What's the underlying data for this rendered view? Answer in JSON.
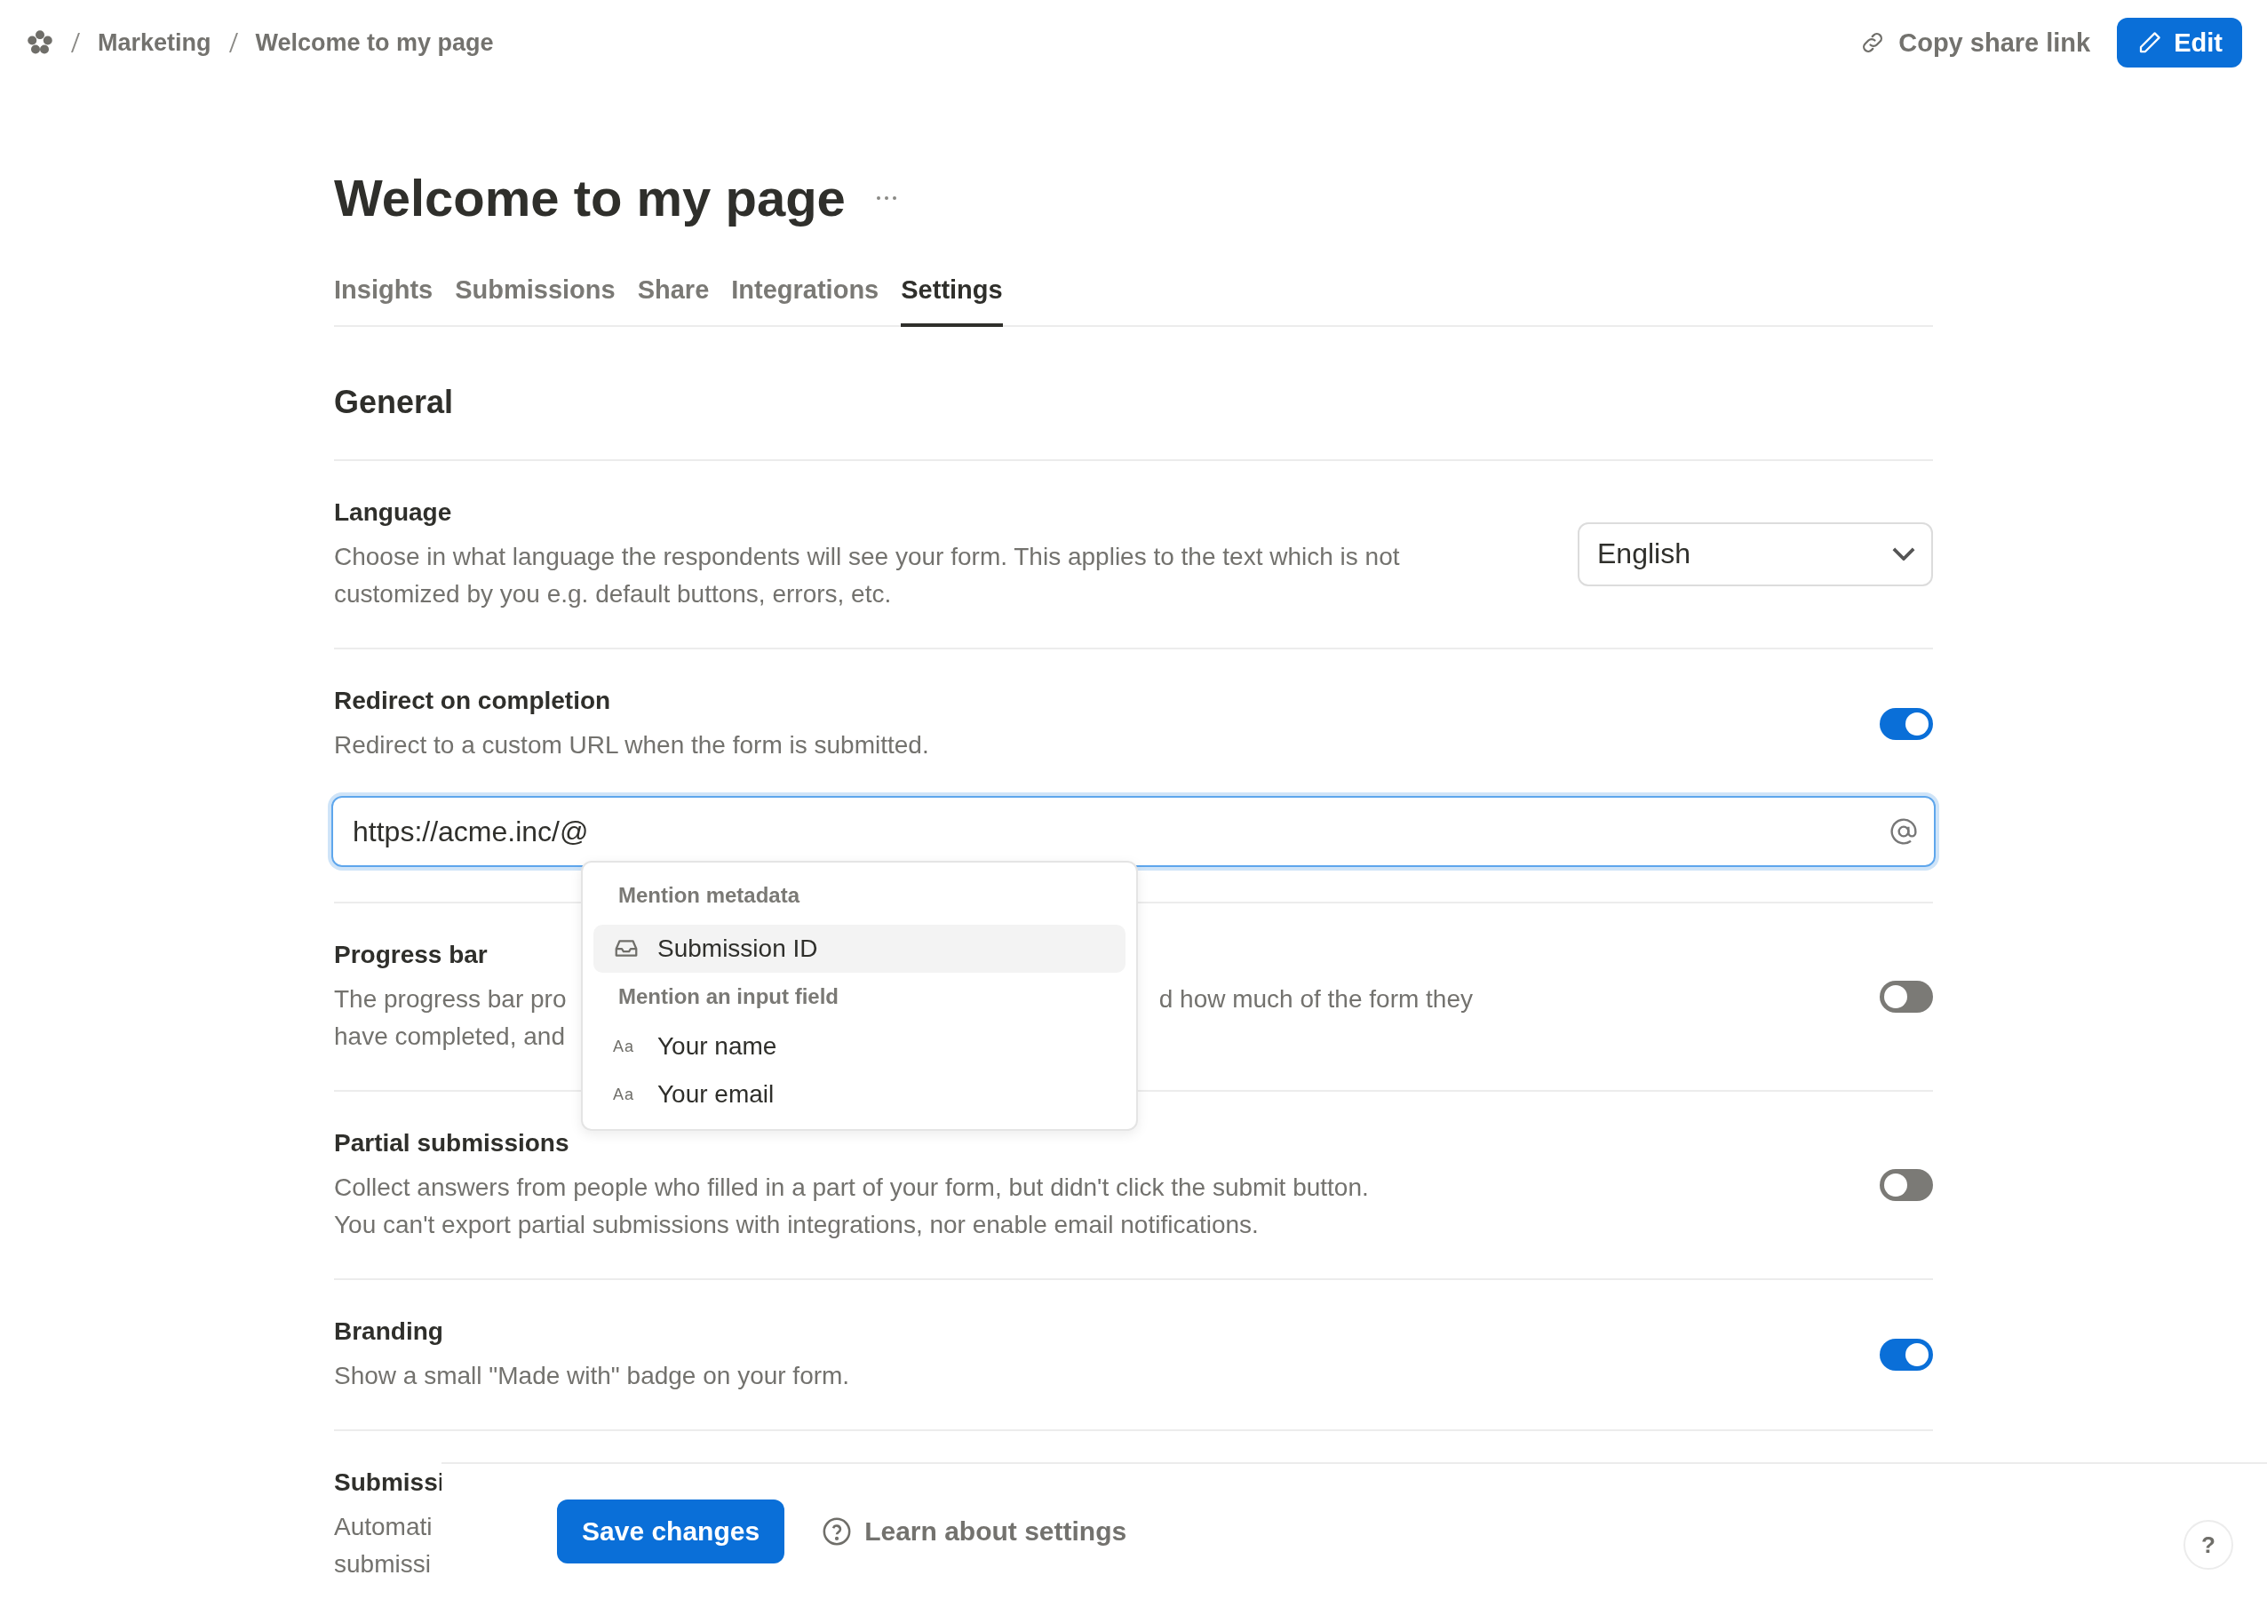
{
  "breadcrumb": [
    "Marketing",
    "Welcome to my page"
  ],
  "header_actions": {
    "copy_link": "Copy share link",
    "edit": "Edit"
  },
  "title": "Welcome to my page",
  "tabs": [
    {
      "label": "Insights",
      "selected": false
    },
    {
      "label": "Submissions",
      "selected": false
    },
    {
      "label": "Share",
      "selected": false
    },
    {
      "label": "Integrations",
      "selected": false
    },
    {
      "label": "Settings",
      "selected": true
    }
  ],
  "section_heading": "General",
  "settings": [
    {
      "kind": "select",
      "title": "Language",
      "description": [
        [
          "Choose in what language the respondents will see your form. This applies to the text which is not"
        ],
        [
          "customized by you e.g. default buttons, errors, etc."
        ]
      ],
      "value": "English"
    },
    {
      "kind": "toggle",
      "title": "Redirect on completion",
      "description": [
        [
          "Redirect to a custom URL when the form is submitted."
        ]
      ],
      "on": true,
      "url_field": {
        "value": "https://acme.inc/@"
      }
    },
    {
      "kind": "toggle",
      "title": "Progress bar",
      "description": [
        [
          "The progress bar pro",
          "d how much of the form they"
        ],
        [
          "have completed, and"
        ]
      ],
      "on": false
    },
    {
      "kind": "toggle",
      "title": "Partial submissions",
      "description": [
        [
          "Collect answers from people who filled in a part of your form, but didn't click the submit button."
        ],
        [
          "You can't export partial submissions with integrations, nor enable email notifications."
        ]
      ],
      "on": false
    },
    {
      "kind": "toggle",
      "title": "Branding",
      "description": [
        [
          "Show a small \"Made with\" badge on your form."
        ]
      ],
      "on": true
    },
    {
      "kind": "covered",
      "title": "Submissi",
      "description": [
        [
          "Automati"
        ],
        [
          "submissi"
        ]
      ]
    }
  ],
  "mention_menu": [
    {
      "heading": "Mention metadata",
      "items": [
        {
          "kind": "metadata",
          "label": "Submission ID",
          "selected": true
        }
      ]
    },
    {
      "heading": "Mention an input field",
      "items": [
        {
          "kind": "text",
          "glyph": "Aa",
          "label": "Your name",
          "selected": false
        },
        {
          "kind": "text",
          "glyph": "Aa",
          "label": "Your email",
          "selected": false
        }
      ]
    }
  ],
  "footer": {
    "save": "Save changes",
    "learn": "Learn about settings",
    "help": "?"
  }
}
